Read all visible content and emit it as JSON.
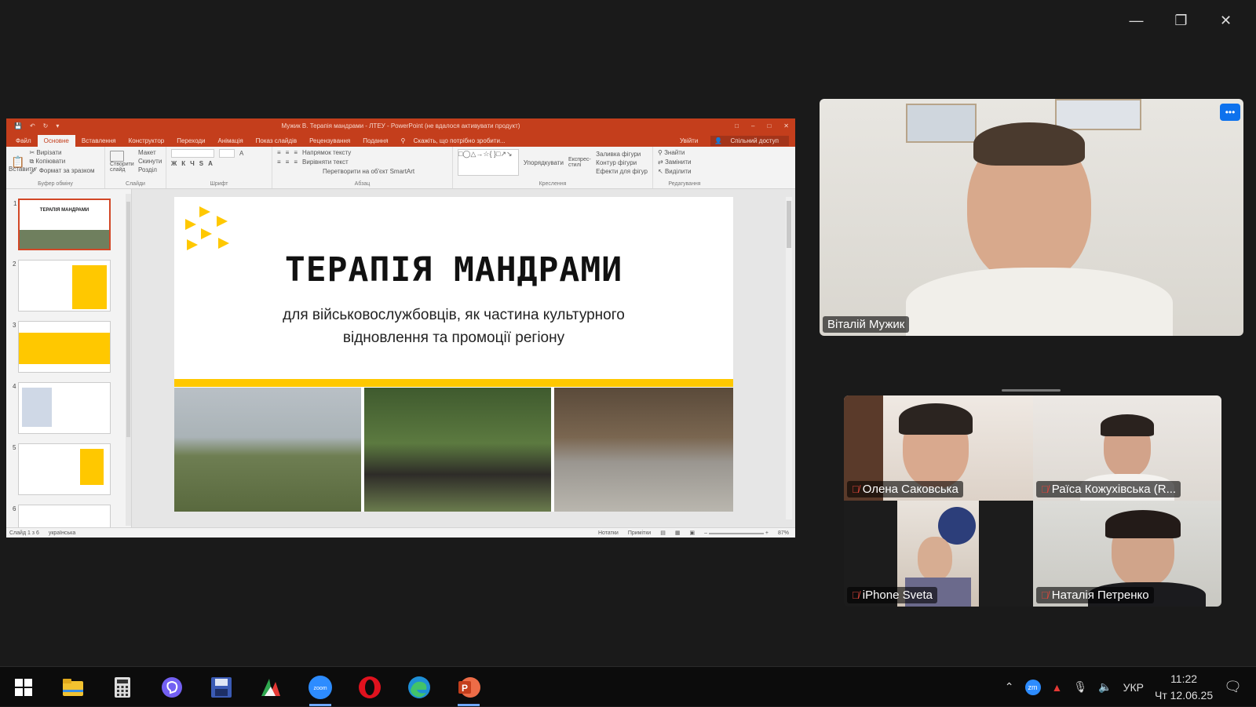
{
  "ppt": {
    "doc_title": "Мужик В. Терапія мандрами - ЛТЕУ - PowerPoint (не вдалося активувати продукт)",
    "tabs": [
      "Файл",
      "Основне",
      "Вставлення",
      "Конструктор",
      "Переходи",
      "Анімація",
      "Показ слайдів",
      "Рецензування",
      "Подання"
    ],
    "tell_me": "Скажіть, що потрібно зробити...",
    "sign_in": "Увійти",
    "share": "Спільний доступ",
    "ribbon": {
      "paste": "Вставити",
      "cut": "Вирізати",
      "copy": "Копіювати",
      "format_painter": "Формат за зразком",
      "clipboard_group": "Буфер обміну",
      "new_slide": "Створити слайд",
      "layout": "Макет",
      "reset": "Скинути",
      "section": "Розділ",
      "slides_group": "Слайди",
      "font_group": "Шрифт",
      "text_direction": "Напрямок тексту",
      "align_text": "Вирівняти текст",
      "smartart": "Перетворити на об'єкт SmartArt",
      "paragraph_group": "Абзац",
      "arrange": "Упорядкувати",
      "quick_styles": "Експрес-стилі",
      "shape_fill": "Заливка фігури",
      "shape_outline": "Контур фігури",
      "shape_effects": "Ефекти для фігур",
      "drawing_group": "Креслення",
      "find": "Знайти",
      "replace": "Замінити",
      "select": "Виділити",
      "editing_group": "Редагування"
    },
    "thumbnails": [
      {
        "num": "1",
        "title": "ТЕРАПІЯ МАНДРАМИ"
      },
      {
        "num": "2",
        "title": ""
      },
      {
        "num": "3",
        "title": ""
      },
      {
        "num": "4",
        "title": ""
      },
      {
        "num": "5",
        "title": ""
      },
      {
        "num": "6",
        "title": ""
      }
    ],
    "slide": {
      "title": "ТЕРАПІЯ МАНДРАМИ",
      "subtitle_line1": "для військовослужбовців, як частина культурного",
      "subtitle_line2": "відновлення та промоції регіону"
    },
    "status": {
      "slide_counter": "Слайд 1 з 6",
      "language": "українська",
      "notes": "Нотатки",
      "comments": "Примітки",
      "zoom": "87%"
    }
  },
  "participants": {
    "speaker": {
      "name": "Віталій Мужик"
    },
    "grid": [
      {
        "name": "Олена Саковська"
      },
      {
        "name": "Раїса Кожухівська (R..."
      },
      {
        "name": "iPhone Sveta"
      },
      {
        "name": "Наталія Петренко"
      }
    ]
  },
  "taskbar": {
    "apps": [
      "windows-start",
      "file-explorer",
      "calculator",
      "viber",
      "save-app",
      "photos-app",
      "zoom",
      "opera",
      "edge",
      "powerpoint"
    ],
    "language": "УКР",
    "time": "11:22",
    "date": "Чт 12.06.25"
  },
  "colors": {
    "ppt_accent": "#c43e1c",
    "slide_yellow": "#ffc800",
    "zoom_blue": "#0e72ed",
    "muted_red": "#e0463b"
  }
}
